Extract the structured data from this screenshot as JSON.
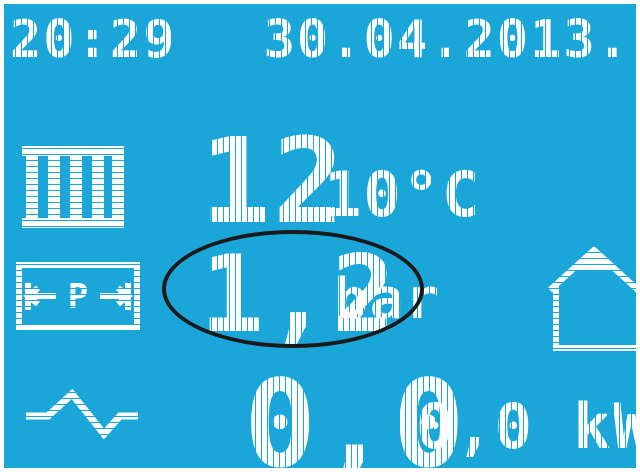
{
  "colors": {
    "screen_background": "#1BA6D9",
    "foreground": "#FFFFFF",
    "outer_frame": "#FFFFFF",
    "ellipse_stroke": "#1A1A1A"
  },
  "status_bar": {
    "time": "20:29",
    "date": "30.04.2013."
  },
  "temperature": {
    "icon": "radiator-icon",
    "main_value": "12",
    "secondary_value": "10°C"
  },
  "pressure": {
    "icon": "pressure-gauge-icon",
    "value": "1,2",
    "unit": "bar",
    "highlighted": true
  },
  "power": {
    "icon": "wave-icon",
    "main_value": "0,0",
    "secondary_value": "0,0 kW"
  },
  "mode": {
    "icon": "house-icon"
  }
}
